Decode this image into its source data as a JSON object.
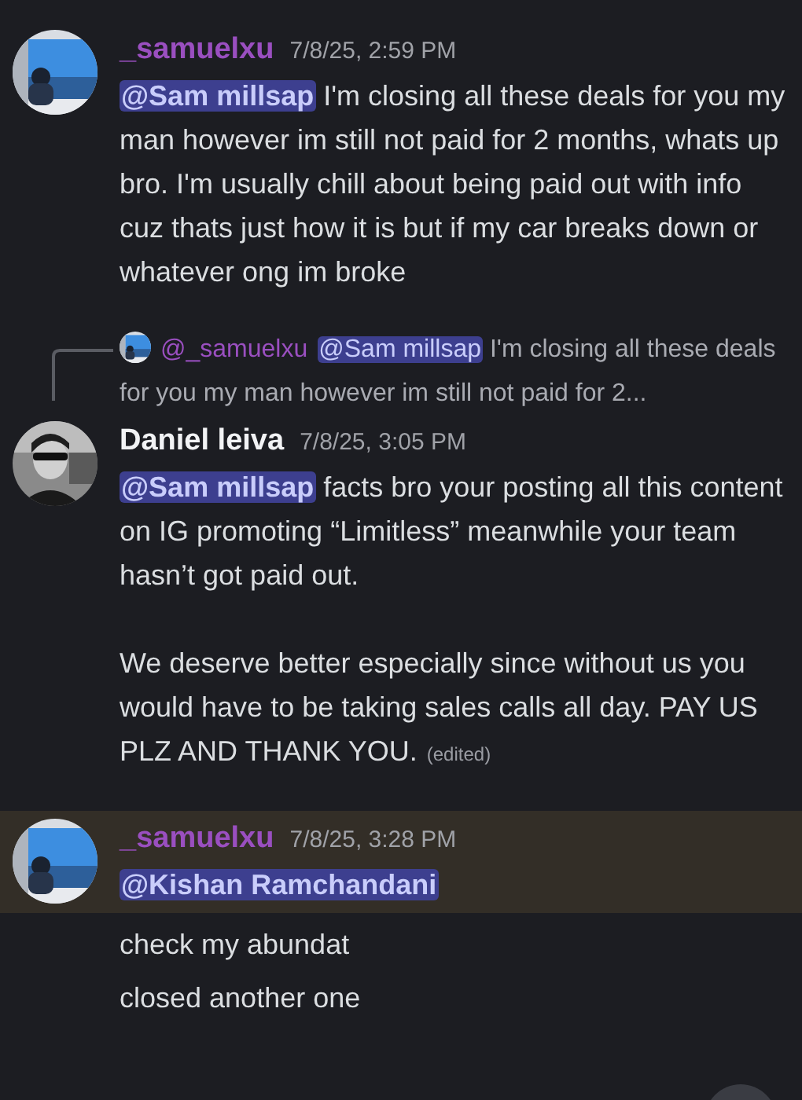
{
  "messages": [
    {
      "author": "_samuelxu",
      "color": "#9a4fc0",
      "timestamp": "7/8/25, 2:59 PM",
      "highlighted": false,
      "avatar": {
        "kind": "picture"
      },
      "paragraphs": [
        {
          "mention": "@Sam millsap",
          "text": " I'm closing all these deals for you my man however im still not paid for 2 months, whats up bro. I'm usually chill about being paid out with info cuz thats just how it is but if my car breaks down or whatever ong im broke"
        }
      ]
    },
    {
      "author": "Daniel leiva",
      "color": "#f2f3f5",
      "timestamp": "7/8/25, 3:05 PM",
      "highlighted": false,
      "avatar": {
        "kind": "picture"
      },
      "reply": {
        "author": "@_samuelxu",
        "mention": "@Sam millsap",
        "text": " I'm closing all these deals for you my man however im still not paid for 2..."
      },
      "paragraphs": [
        {
          "mention": "@Sam millsap",
          "text": " facts bro your posting all this content on IG promoting “Limitless” meanwhile your team hasn’t got paid out."
        },
        {
          "text": "We deserve better especially since without us you would have to be taking sales calls all day. PAY US PLZ AND THANK YOU."
        }
      ],
      "edited": "(edited)"
    },
    {
      "author": "_samuelxu",
      "color": "#9a4fc0",
      "timestamp": "7/8/25, 3:28 PM",
      "highlighted": true,
      "avatar": {
        "kind": "picture"
      },
      "paragraphs": [
        {
          "mention": "@Kishan Ramchandani"
        }
      ],
      "followups": [
        "check my abundat",
        "closed another one"
      ]
    }
  ]
}
